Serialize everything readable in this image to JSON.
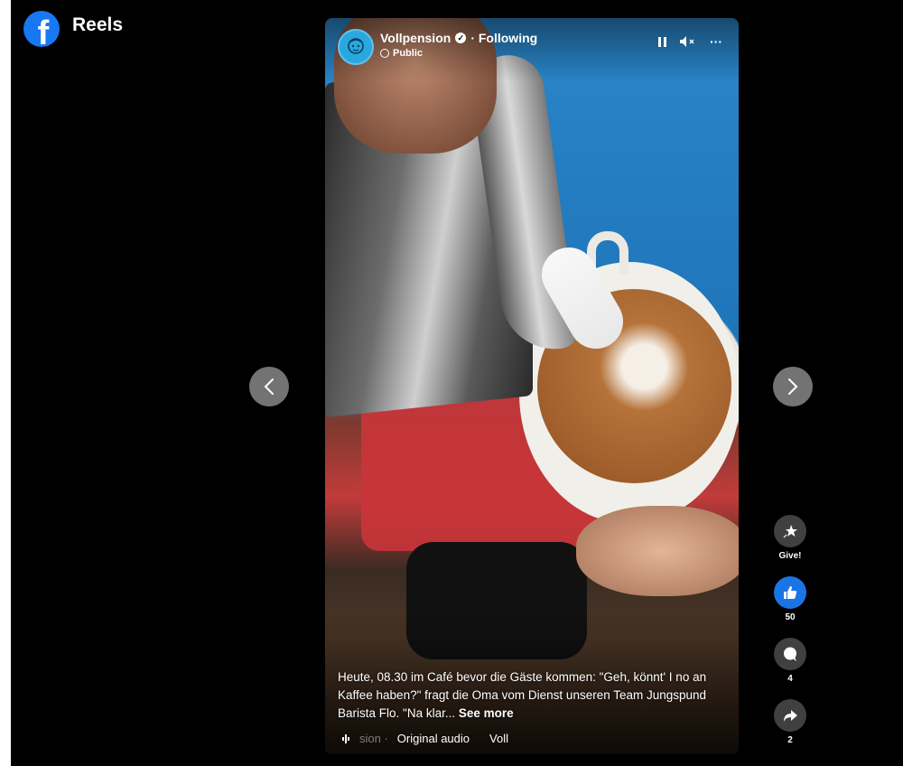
{
  "header": {
    "logo_letter": "f",
    "title": "Reels"
  },
  "reel": {
    "author": "Vollpension",
    "follow_status": "· Following",
    "privacy": "Public",
    "caption_text": "Heute, 08.30 im Café bevor die Gäste kommen: \"Geh, könnt' I no an Kaffee haben?\" fragt die Oma vom Dienst unseren Team Jungspund Barista Flo. \"Na klar...",
    "see_more": "See more",
    "audio_owner_faded": "sion ·",
    "audio_label": "Original audio",
    "audio_scroll": "Voll",
    "more_label": "···"
  },
  "actions": {
    "give_label": "Give!",
    "like_count": "50",
    "comment_count": "4",
    "share_count": "2"
  },
  "colors": {
    "accent": "#1877f2",
    "like": "#1b74e4"
  }
}
